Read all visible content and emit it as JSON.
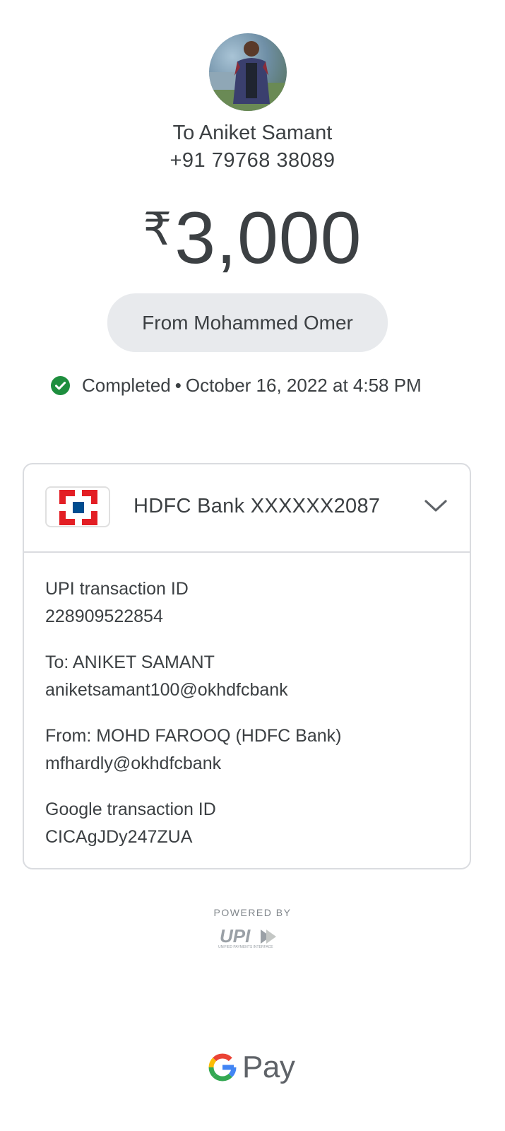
{
  "recipient": {
    "name_line": "To Aniket Samant",
    "phone": "+91 79768 38089"
  },
  "amount": {
    "currency_symbol": "₹",
    "value": "3,000"
  },
  "note_pill": "From Mohammed Omer",
  "status": {
    "label": "Completed",
    "separator": "•",
    "datetime": "October 16, 2022 at 4:58 PM",
    "color": "#1e8e3e"
  },
  "account": {
    "bank_label": "HDFC Bank XXXXXX2087",
    "logo_colors": {
      "red": "#e31e24",
      "blue": "#004c8f"
    }
  },
  "details": [
    {
      "key": "UPI transaction ID",
      "value": "228909522854"
    },
    {
      "key": "To: ANIKET SAMANT",
      "value": "aniketsamant100@okhdfcbank"
    },
    {
      "key": "From: MOHD FAROOQ (HDFC Bank)",
      "value": "mfhardly@okhdfcbank"
    },
    {
      "key": "Google transaction ID",
      "value": "CICAgJDy247ZUA"
    }
  ],
  "footer": {
    "powered_by": "POWERED BY",
    "upi_mark": "UPI",
    "upi_tagline": "UNIFIED PAYMENTS INTERFACE",
    "brand_g": "G",
    "brand_pay": "Pay"
  },
  "icons": {
    "status": "check-circle-icon",
    "expand": "chevron-down-icon"
  }
}
